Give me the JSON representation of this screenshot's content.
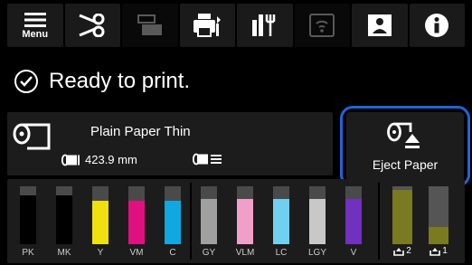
{
  "toolbar": {
    "menu_label": "Menu",
    "buttons": [
      {
        "name": "menu-icon"
      },
      {
        "name": "scissors-icon"
      },
      {
        "name": "paper-feed-icon"
      },
      {
        "name": "printer-settings-icon"
      },
      {
        "name": "print-head-icon"
      },
      {
        "name": "wifi-icon"
      },
      {
        "name": "book-help-icon"
      },
      {
        "name": "info-icon"
      }
    ]
  },
  "status": {
    "icon": "check-circle-icon",
    "text": "Ready to print."
  },
  "paper": {
    "type": "Plain Paper Thin",
    "roll_length": "423.9 mm"
  },
  "eject": {
    "label": "Eject Paper",
    "highlight_color": "#1e64d8"
  },
  "inks": [
    {
      "label": "PK",
      "color": "#000000",
      "level": 0.85
    },
    {
      "label": "MK",
      "color": "#000000",
      "level": 0.85
    },
    {
      "label": "Y",
      "color": "#f0e010",
      "level": 0.75
    },
    {
      "label": "VM",
      "color": "#e01080",
      "level": 0.75
    },
    {
      "label": "C",
      "color": "#10a8e0",
      "level": 0.75
    },
    {
      "label": "GY",
      "color": "#a0a0a0",
      "level": 0.78
    },
    {
      "label": "VLM",
      "color": "#f0a0c8",
      "level": 0.78
    },
    {
      "label": "LC",
      "color": "#70d0f0",
      "level": 0.78
    },
    {
      "label": "LGY",
      "color": "#c8c8c8",
      "level": 0.78
    },
    {
      "label": "V",
      "color": "#7030c0",
      "level": 0.78
    }
  ],
  "maintenance": [
    {
      "label": "2",
      "level": 0.93
    },
    {
      "label": "1",
      "level": 0.3
    }
  ]
}
